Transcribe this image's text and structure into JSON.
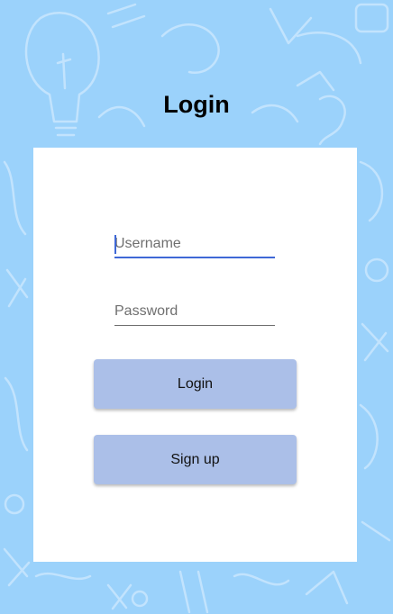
{
  "page": {
    "title": "Login"
  },
  "form": {
    "username": {
      "placeholder": "Username",
      "value": ""
    },
    "password": {
      "placeholder": "Password",
      "value": ""
    },
    "login_button_label": "Login",
    "signup_button_label": "Sign up"
  },
  "colors": {
    "background": "#9bd2fb",
    "card": "#ffffff",
    "button": "#abbfe8",
    "focus_accent": "#3f68d6"
  }
}
